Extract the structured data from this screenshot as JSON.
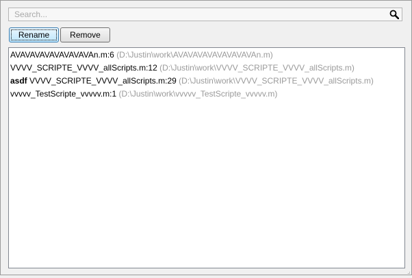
{
  "search": {
    "placeholder": "Search...",
    "value": "",
    "icon": "magnifier-icon"
  },
  "toolbar": {
    "rename_label": "Rename",
    "remove_label": "Remove"
  },
  "results": [
    {
      "prefix": "",
      "name": "AVAVAVAVAVAVAVAVAn.m:",
      "line": "6",
      "path": "(D:\\Justin\\work\\AVAVAVAVAVAVAVAVAn.m)"
    },
    {
      "prefix": "",
      "name": "VVVV_SCRIPTE_VVVV_allScripts.m:",
      "line": "12",
      "path": "(D:\\Justin\\work\\VVVV_SCRIPTE_VVVV_allScripts.m)"
    },
    {
      "prefix": "asdf",
      "name": "VVVV_SCRIPTE_VVVV_allScripts.m:",
      "line": "29",
      "path": "(D:\\Justin\\work\\VVVV_SCRIPTE_VVVV_allScripts.m)"
    },
    {
      "prefix": "",
      "name": "vvvvv_TestScripte_vvvvv.m:",
      "line": "1",
      "path": "(D:\\Justin\\work\\vvvvv_TestScripte_vvvvv.m)"
    }
  ],
  "colors": {
    "path_text": "#9a9a9a",
    "focus_button_border": "#3c7fb1",
    "background": "#f0f0f0"
  }
}
